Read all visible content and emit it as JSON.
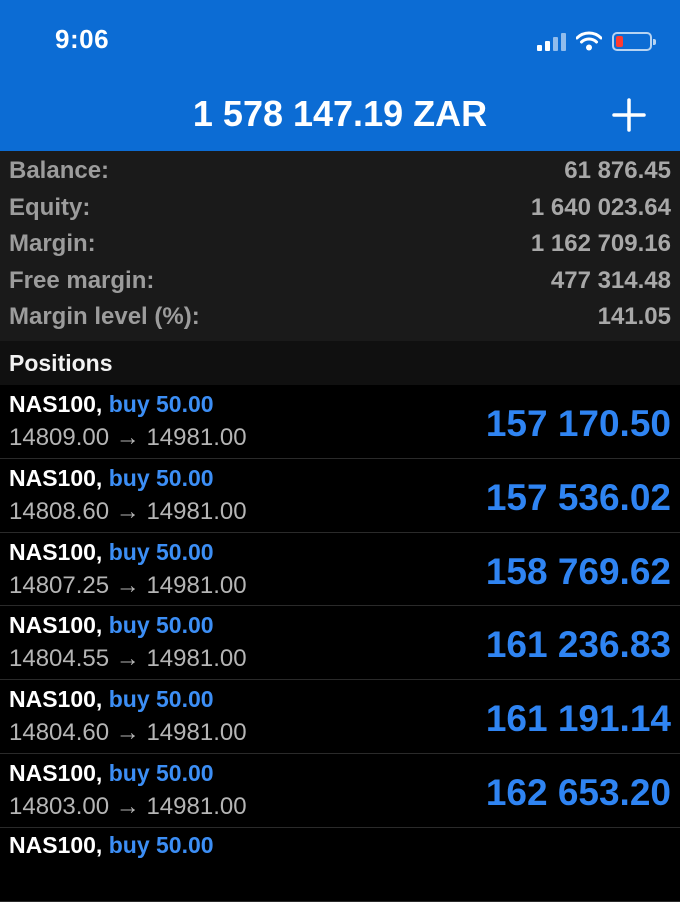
{
  "status_bar": {
    "time": "9:06"
  },
  "header": {
    "title": "1 578 147.19 ZAR"
  },
  "summary": [
    {
      "label": "Balance:",
      "value": "61 876.45"
    },
    {
      "label": "Equity:",
      "value": "1 640 023.64"
    },
    {
      "label": "Margin:",
      "value": "1 162 709.16"
    },
    {
      "label": "Free margin:",
      "value": "477 314.48"
    },
    {
      "label": "Margin level (%):",
      "value": "141.05"
    }
  ],
  "positions_header": "Positions",
  "positions": [
    {
      "symbol": "NAS100,",
      "side": "buy 50.00",
      "open": "14809.00",
      "arrow": "→",
      "current": "14981.00",
      "profit": "157 170.50"
    },
    {
      "symbol": "NAS100,",
      "side": "buy 50.00",
      "open": "14808.60",
      "arrow": "→",
      "current": "14981.00",
      "profit": "157 536.02"
    },
    {
      "symbol": "NAS100,",
      "side": "buy 50.00",
      "open": "14807.25",
      "arrow": "→",
      "current": "14981.00",
      "profit": "158 769.62"
    },
    {
      "symbol": "NAS100,",
      "side": "buy 50.00",
      "open": "14804.55",
      "arrow": "→",
      "current": "14981.00",
      "profit": "161 236.83"
    },
    {
      "symbol": "NAS100,",
      "side": "buy 50.00",
      "open": "14804.60",
      "arrow": "→",
      "current": "14981.00",
      "profit": "161 191.14"
    },
    {
      "symbol": "NAS100,",
      "side": "buy 50.00",
      "open": "14803.00",
      "arrow": "→",
      "current": "14981.00",
      "profit": "162 653.20"
    },
    {
      "symbol": "NAS100,",
      "side": "buy 50.00",
      "open": "",
      "arrow": "",
      "current": "",
      "profit": ""
    }
  ],
  "colors": {
    "header_bg": "#0c6cd4",
    "accent_blue": "#2f84f2",
    "battery_low": "#ff3b30"
  },
  "icons": [
    "cellular-signal-icon",
    "wifi-icon",
    "battery-icon",
    "plus-icon"
  ]
}
